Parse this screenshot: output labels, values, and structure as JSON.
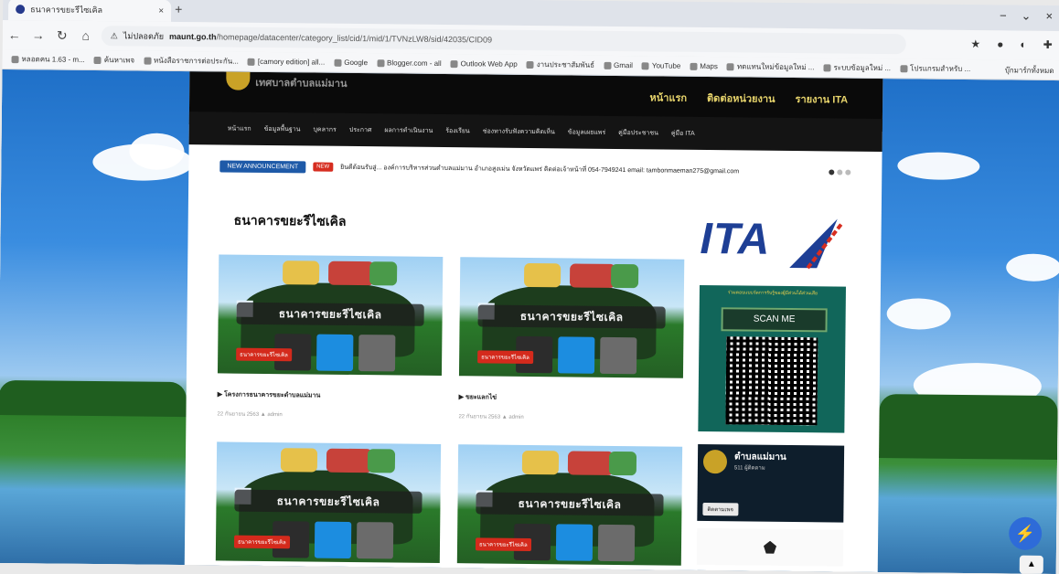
{
  "browser": {
    "tab_title": "ธนาคารขยะรีไซเคิล",
    "url_host": "maunt.go.th",
    "url_path": "/homepage/datacenter/category_list/cid/1/mid/1/TVNzLW8/sid/42035/CID09",
    "url_security": "ไม่ปลอดภัย",
    "bookmarks": [
      "หลอดคน 1.63 - m...",
      "ค้นหาเพจ",
      "หนังสือราชการต่อประกัน...",
      "[camory edition] all...",
      "Google",
      "Blogger.com - all",
      "Outlook Web App",
      "งานประชาสัมพันธ์",
      "Gmail",
      "YouTube",
      "Maps",
      "ทดแทนใหม่ข้อมูลใหม่ ...",
      "ระบบข้อมูลใหม่ ...",
      "โปรแกรมสำหรับ ..."
    ],
    "bookmark_all": "บุ๊กมาร์กทั้งหมด"
  },
  "site": {
    "name": "เทศบาลตำบลแม่มาน",
    "top_links": [
      "หน้าแรก",
      "ติดต่อหน่วยงาน",
      "รายงาน ITA"
    ],
    "menu": [
      "หน้าแรก",
      "ข้อมูลพื้นฐาน",
      "บุคลากร",
      "ประกาศ",
      "ผลการดำเนินงาน",
      "ร้องเรียน",
      "ช่องทางรับฟังความคิดเห็น",
      "ข้อมูลเผยแพร่",
      "คู่มือประชาชน",
      "คู่มือ ITA"
    ],
    "news_label": "NEW ANNOUNCEMENT",
    "news_new": "NEW",
    "news_text": "ยินดีต้อนรับสู่... องค์การบริหารส่วนตำบลแม่มาน อำเภอสูงเม่น จังหวัดแพร่ ติดต่อเจ้าหน้าที่ 054-7949241 email: tambonmaeman275@gmail.com",
    "page_title": "ธนาคารขยะรีไซเคิล",
    "cards": [
      {
        "image_text": "ธนาคารขยะรีไซเคิล",
        "tag": "ธนาคารขยะรีไซเคิล",
        "title": "▶ โครงการธนาคารขยะตำบลแม่มาน",
        "meta": "22 กันยายน 2563   ▲ admin"
      },
      {
        "image_text": "ธนาคารขยะรีไซเคิล",
        "tag": "ธนาคารขยะรีไซเคิล",
        "title": "▶ ขยะแลกไข่",
        "meta": "22 กันยายน 2563   ▲ admin"
      },
      {
        "image_text": "ธนาคารขยะรีไซเคิล",
        "tag": "ธนาคารขยะรีไซเคิล",
        "title": "",
        "meta": ""
      },
      {
        "image_text": "ธนาคารขยะรีไซเคิล",
        "tag": "ธนาคารขยะรีไซเคิล",
        "title": "",
        "meta": ""
      }
    ]
  },
  "sidebar": {
    "ita_text": "ITA",
    "scan_title": "ร่วมตอบแบบวัดการรับรู้ของผู้มีส่วนได้ส่วนเสีย",
    "scan_label": "SCAN ME",
    "fb_name": "ตำบลแม่มาน",
    "fb_sub": "511 ผู้ติดตาม",
    "fb_button": "ติดตามเพจ"
  },
  "colors": {
    "accent": "#1e5aa8",
    "site_header": "#0a0a0a",
    "ita_blue": "#1e3f95",
    "scan_bg": "#11665a"
  },
  "icons": {
    "messenger": "messenger-icon",
    "back_to_top": "chevron-up-icon"
  }
}
